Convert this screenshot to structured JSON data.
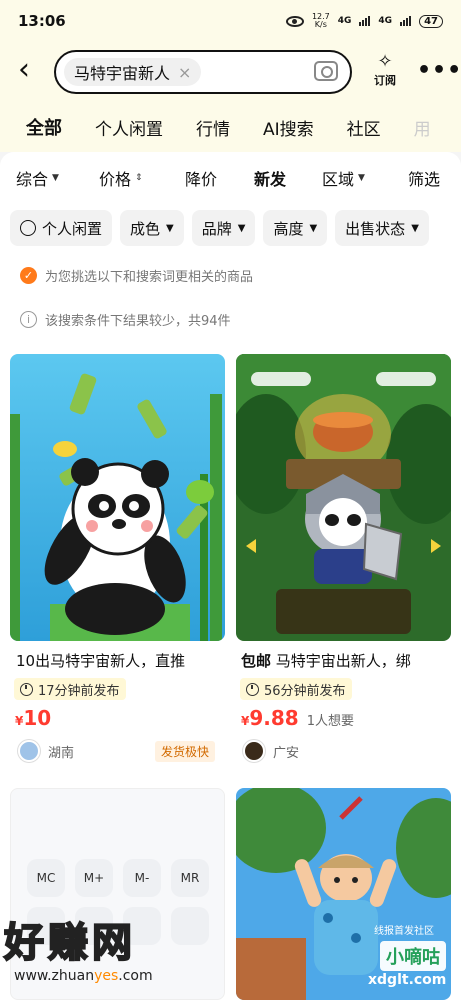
{
  "status": {
    "time": "13:06",
    "speed_top": "12.7",
    "speed_bottom": "K/s",
    "net1": "4G",
    "net2": "4G",
    "battery": "47"
  },
  "search": {
    "query": "马特宇宙新人",
    "clear": "×",
    "subscribe": "订阅",
    "more": "•••",
    "back": "‹"
  },
  "category_tabs": [
    "全部",
    "个人闲置",
    "行情",
    "AI搜索",
    "社区",
    "用"
  ],
  "sort": {
    "overall": "综合",
    "price": "价格",
    "price_drop": "降价",
    "newest": "新发",
    "region": "区域",
    "filter": "筛选"
  },
  "filters": [
    "个人闲置",
    "成色",
    "品牌",
    "高度",
    "出售状态"
  ],
  "notices": {
    "picked": "为您挑选以下和搜索词更相关的商品",
    "few_results": "该搜索条件下结果较少，共94件"
  },
  "products": [
    {
      "title": "10出马特宇宙新人，直推",
      "time": "17分钟前发布",
      "currency": "¥",
      "price": "10",
      "location": "湖南",
      "badge": "发货极快"
    },
    {
      "free_ship": "包邮",
      "title": "马特宇宙出新人，绑",
      "time": "56分钟前发布",
      "currency": "¥",
      "price": "9.88",
      "wants": "1人想要",
      "location": "广安"
    }
  ],
  "calc_keys": [
    "MC",
    "M+",
    "M-",
    "MR"
  ],
  "watermark": {
    "main": "好赚网",
    "url_a": "www.zhuan",
    "url_b": "yes",
    "url_c": ".com"
  },
  "brand": {
    "label": "小嘀咕",
    "sub": "线报首发社区",
    "url": "xdglt.com"
  }
}
